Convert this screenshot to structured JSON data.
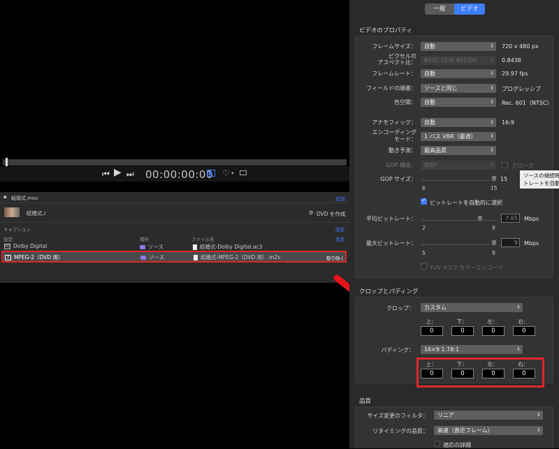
{
  "player": {
    "timecode": "00:00:00:00",
    "icons": [
      "skip-back-icon",
      "play-icon",
      "skip-forward-icon",
      "viewer-layout-icon",
      "heart-icon",
      "chevron-down-icon",
      "screen-icon"
    ]
  },
  "share": {
    "file_name": "結婚式.mov",
    "file_action": "追加",
    "project_name": "結婚式.r",
    "create_dvd": "DVD を作成",
    "captions_label": "キャプション",
    "captions_action": "設定",
    "col_setting": "設定",
    "col_location": "場所",
    "col_filename": "ファイル名",
    "col_action": "設定",
    "rows": [
      {
        "setting": "Dolby Digital",
        "location": "ソース",
        "filename": "結婚式-Dolby Digital.ac3",
        "action": ""
      },
      {
        "setting": "MPEG-2（DVD 用）",
        "location": "ソース",
        "filename": "結婚式-MPEG-2（DVD 用）.m2v",
        "action": "取り除く"
      }
    ]
  },
  "inspector": {
    "tabs": [
      "一般",
      "ビデオ"
    ],
    "active_tab": "ビデオ",
    "video_section": "ビデオのプロパティ",
    "frame_size_label": "フレームサイズ：",
    "frame_size_value": "自動",
    "frame_size_readout": "720 x 480 px",
    "pixel_aspect_label_1": "ピクセルの",
    "pixel_aspect_label_2": "アスペクト比：",
    "pixel_aspect_value": "NTSC CCIR 601/DV",
    "pixel_aspect_readout": "0.8438",
    "frame_rate_label": "フレームレート：",
    "frame_rate_value": "自動",
    "frame_rate_readout": "29.97 fps",
    "field_order_label": "フィールドの順番：",
    "field_order_value": "ソースと同じ",
    "field_order_readout": "プログレッシブ",
    "color_space_label": "色空間：",
    "color_space_value": "自動",
    "color_space_readout": "Rec. 601（NTSC）",
    "anamorphic_label": "アナモフィック：",
    "anamorphic_value": "自動",
    "anamorphic_readout": "16:9",
    "encoding_mode_label_1": "エンコーディング",
    "encoding_mode_label_2": "モード：",
    "encoding_mode_value": "1 パス VBR（最適）",
    "motion_estimation_label": "動き予測：",
    "motion_estimation_value": "最高品質",
    "gop_structure_label": "GOP 構造：",
    "gop_structure_value": "IBBP",
    "gop_closed_label": "クローズ",
    "gop_size_label": "GOP サイズ：",
    "gop_size_min": "6",
    "gop_size_max": "15",
    "gop_size_readout": "15",
    "auto_bitrate_label": "ビットレートを自動的に選択",
    "auto_bitrate_checked": true,
    "avg_bitrate_label": "平均ビットレート：",
    "avg_bitrate_min": "2",
    "avg_bitrate_max": "9",
    "avg_bitrate_value": "7.65",
    "avg_bitrate_unit": "Mbps",
    "max_bitrate_label": "最大ビットレート：",
    "max_bitrate_min": "5",
    "max_bitrate_max": "9",
    "max_bitrate_value": "9",
    "max_bitrate_unit": "Mbps",
    "yuv_label": "YUV 4:2:2 カラーエンコード",
    "crop_section": "クロップとパディング",
    "crop_label": "クロップ：",
    "crop_value": "カスタム",
    "crop_edges": [
      {
        "label": "上：",
        "value": "0"
      },
      {
        "label": "下：",
        "value": "0"
      },
      {
        "label": "左：",
        "value": "0"
      },
      {
        "label": "右：",
        "value": "0"
      }
    ],
    "padding_label": "パディング：",
    "padding_value": "16×9 1.78:1",
    "padding_edges": [
      {
        "label": "上：",
        "value": "0"
      },
      {
        "label": "下：",
        "value": "0"
      },
      {
        "label": "左：",
        "value": "0"
      },
      {
        "label": "右：",
        "value": "0"
      }
    ],
    "quality_section": "品質",
    "resize_filter_label": "サイズ変更のフィルタ：",
    "resize_filter_value": "リニア",
    "retiming_label": "リタイミングの品質：",
    "retiming_value": "高速（直近フレーム）",
    "adaptive_detail_label": "適応の詳細",
    "tooltip_line1": "ソースの継続時",
    "tooltip_line2": "トレートを自動"
  },
  "colors": {
    "accent": "#3d7dff",
    "highlight": "#e0262b",
    "panel": "#333333"
  }
}
